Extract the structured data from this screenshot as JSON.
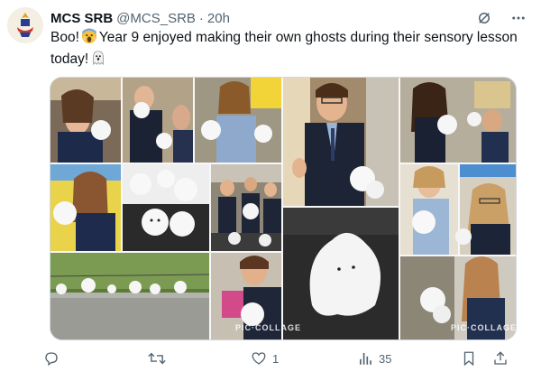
{
  "account": {
    "name": "MCS SRB",
    "handle": "@MCS_SRB",
    "separator": "·",
    "time": "20h"
  },
  "tweet": {
    "part1": "Boo!",
    "part2": "Year 9 enjoyed making their own ghosts during their sensory lesson today!"
  },
  "media": {
    "watermark_1": "PIC·COLLAGE",
    "watermark_2": "PIC·COLLAGE"
  },
  "actions": {
    "reply_count": "",
    "retweet_count": "",
    "like_count": "1",
    "views_count": "35"
  },
  "icons": {
    "header": [
      "grok-icon",
      "more-icon"
    ],
    "actions": [
      "reply-icon",
      "retweet-icon",
      "like-icon",
      "views-icon",
      "bookmark-icon",
      "share-icon"
    ]
  },
  "colors": {
    "text": "#0f1419",
    "secondary": "#536471",
    "border": "#cfd9de"
  }
}
